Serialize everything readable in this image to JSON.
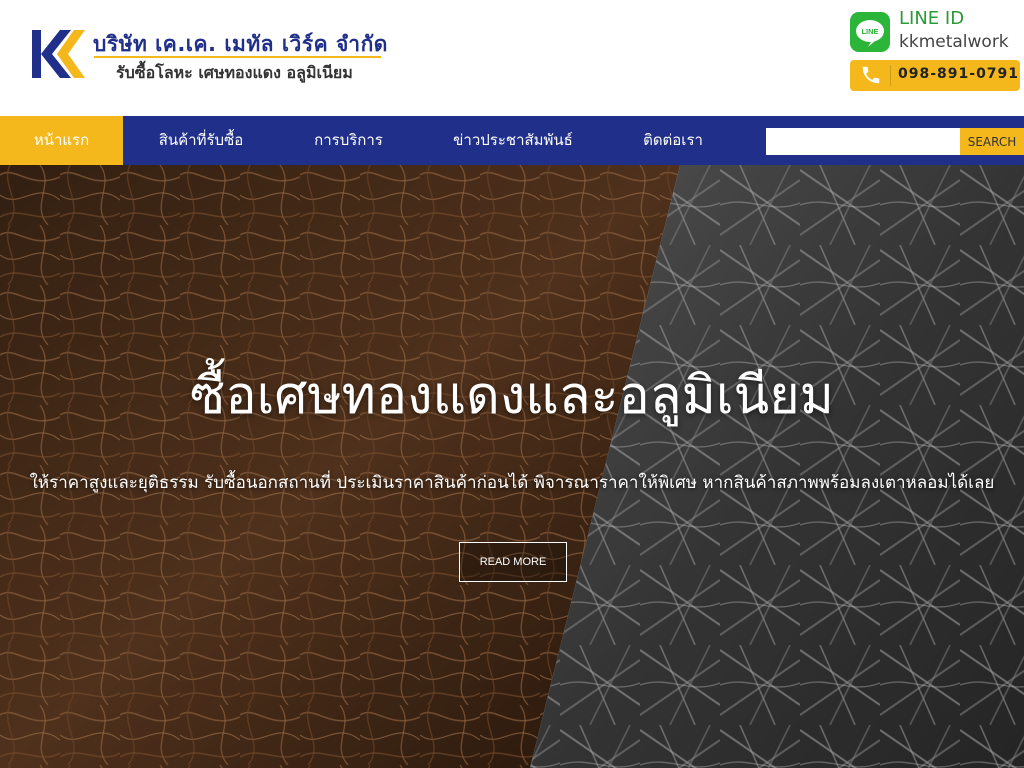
{
  "header": {
    "company_name": "บริษัท เค.เค. เมทัล เวิร์ค จำกัด",
    "tagline": "รับซื้อโลหะ เศษทองแดง อลูมิเนียม",
    "line_id_label": "LINE ID",
    "line_id_value": "kkmetalwork",
    "line_icon_text": "LINE",
    "phone": "098-891-0791"
  },
  "nav": {
    "items": [
      {
        "label": "หน้าแรก",
        "active": true
      },
      {
        "label": "สินค้าที่รับซื้อ",
        "active": false
      },
      {
        "label": "การบริการ",
        "active": false
      },
      {
        "label": "ข่าวประชาสัมพันธ์",
        "active": false
      },
      {
        "label": "ติดต่อเรา",
        "active": false
      }
    ],
    "search_placeholder": "",
    "search_button": "SEARCH"
  },
  "hero": {
    "title": "ซื้อเศษทองแดงและอลูมิเนียม",
    "subtitle": "ให้ราคาสูงและยุติธรรม รับซื้อนอกสถานที่ ประเมินราคาสินค้าก่อนได้ พิจารณาราคาให้พิเศษ หากสินค้าสภาพพร้อมลงเตาหลอมได้เลย",
    "button": "READ MORE"
  },
  "colors": {
    "brand_blue": "#1f2f8a",
    "brand_yellow": "#f4b81c",
    "line_green": "#2bb539"
  }
}
